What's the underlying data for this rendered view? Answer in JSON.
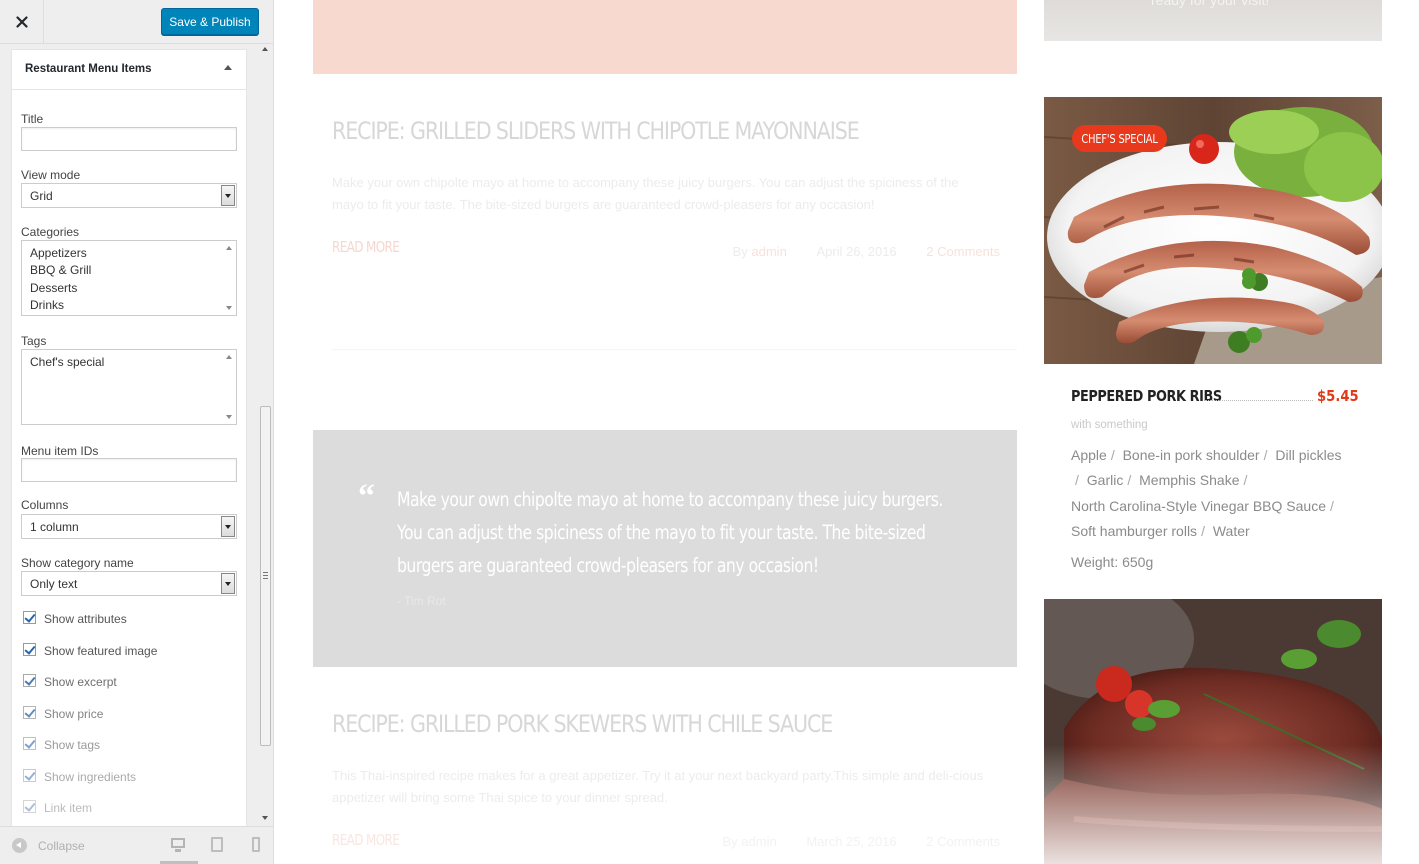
{
  "customizer": {
    "save_label": "Save & Publish",
    "widget_title": "Restaurant Menu Items",
    "fields": {
      "title_label": "Title",
      "title_value": "",
      "view_mode_label": "View mode",
      "view_mode_value": "Grid",
      "categories_label": "Categories",
      "categories": [
        "Appetizers",
        "BBQ & Grill",
        "Desserts",
        "Drinks"
      ],
      "tags_label": "Tags",
      "tags": [
        "Chef's special"
      ],
      "ids_label": "Menu item IDs",
      "ids_value": "",
      "columns_label": "Columns",
      "columns_value": "1 column",
      "show_category_label": "Show category name",
      "show_category_value": "Only text"
    },
    "checkboxes": [
      {
        "label": "Show attributes",
        "checked": true
      },
      {
        "label": "Show featured image",
        "checked": true
      },
      {
        "label": "Show excerpt",
        "checked": true
      },
      {
        "label": "Show price",
        "checked": true
      },
      {
        "label": "Show tags",
        "checked": true
      },
      {
        "label": "Show ingredients",
        "checked": true
      },
      {
        "label": "Link item",
        "checked": true
      }
    ],
    "collapse_label": "Collapse"
  },
  "preview": {
    "top_card_text": "ready for your visit!",
    "posts": [
      {
        "title": "RECIPE: GRILLED SLIDERS WITH CHIPOTLE MAYONNAISE",
        "excerpt": "Make your own chipolte mayo at home to accompany these juicy burgers. You can adjust the spiciness of the mayo to fit your taste. The bite-sized burgers are guaranteed crowd-pleasers for any occasion!",
        "read_more": "READ MORE",
        "by": "By",
        "author": "admin",
        "date": "April 26, 2016",
        "comments": "2 Comments"
      },
      {
        "title": "RECIPE: GRILLED PORK SKEWERS WITH CHILE SAUCE",
        "excerpt": "This Thai-inspired recipe makes for a great appetizer. Try it at your next backyard party.This simple and deli-cious appetizer will bring some Thai spice to your dinner spread.",
        "read_more": "READ MORE",
        "by": "By",
        "author": "admin",
        "date": "March 25, 2016",
        "comments": "2 Comments"
      }
    ],
    "quote": {
      "mark": "“",
      "text": "Make your own chipolte mayo at home to accompany these juicy burgers. You can adjust the spiciness of the mayo to fit your taste. The bite-sized burgers are guaranteed crowd-pleasers for any occasion!",
      "author": "- Tim Rot"
    },
    "menu_item": {
      "badge": "CHEF'S SPECIAL",
      "name": "PEPPERED PORK RIBS",
      "price": "$5.45",
      "description": "with something",
      "ingredients": [
        "Apple",
        "Bone-in pork shoulder",
        "Dill pickles",
        "Garlic",
        "Memphis Shake",
        "North Carolina-Style Vinegar BBQ Sauce",
        "Soft hamburger rolls",
        "Water"
      ],
      "weight": "Weight: 650g"
    }
  },
  "colors": {
    "accent_red": "#e03a17",
    "badge_red": "#e8391c",
    "publish_blue": "#0085ba",
    "pink_block": "#f8d9d0",
    "quote_gray": "#dcdcdc"
  }
}
